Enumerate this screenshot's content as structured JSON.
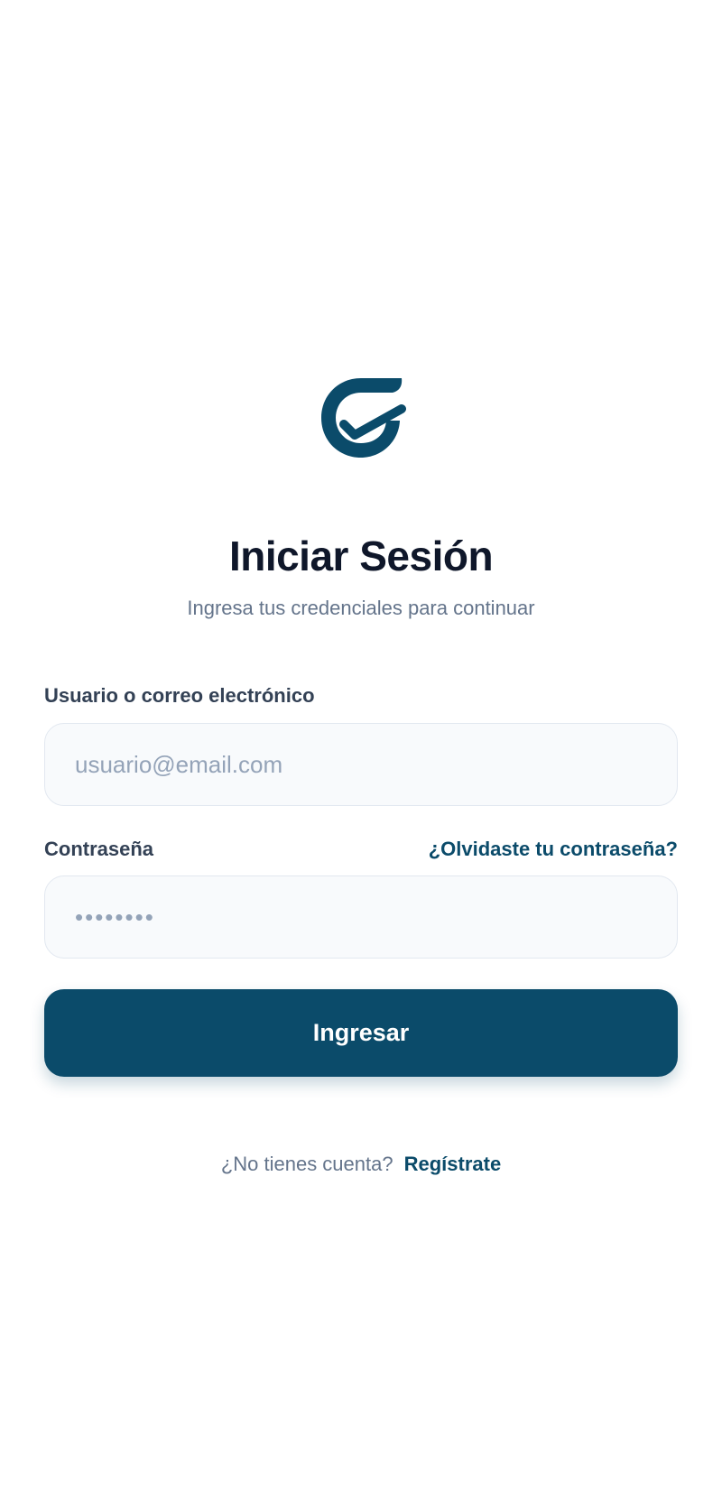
{
  "brand": {
    "logo_icon": "checkmark-g-logo-icon",
    "primary_color": "#0b4b6a"
  },
  "login": {
    "title": "Iniciar Sesión",
    "subtitle": "Ingresa tus credenciales para continuar",
    "user_label": "Usuario o correo electrónico",
    "user_value": "",
    "user_placeholder": "usuario@email.com",
    "password_label": "Contraseña",
    "password_value": "",
    "password_placeholder": "••••••••",
    "forgot_password": "¿Olvidaste tu contraseña?",
    "submit_label": "Ingresar",
    "signup_prompt": "¿No tienes cuenta?",
    "signup_link": "Regístrate"
  }
}
